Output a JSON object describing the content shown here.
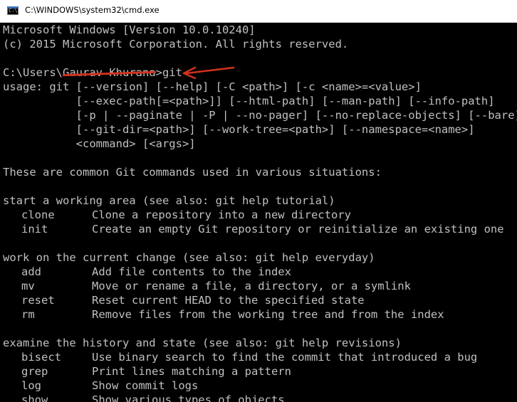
{
  "window": {
    "title": "C:\\WINDOWS\\system32\\cmd.exe",
    "icon": "cmd-console-icon",
    "background_color": "#000000",
    "text_color": "#c0c0c0",
    "annotation_color": "#d2311e"
  },
  "console": {
    "banner_line1": "Microsoft Windows [Version 10.0.10240]",
    "banner_line2": "(c) 2015 Microsoft Corporation. All rights reserved.",
    "prompt_prefix": "C:\\Users\\",
    "prompt_user_redacted": "Gaurav Khurana",
    "prompt_suffix": ">git",
    "usage_lines": [
      "usage: git [--version] [--help] [-C <path>] [-c <name>=<value>]",
      "           [--exec-path[=<path>]] [--html-path] [--man-path] [--info-path]",
      "           [-p | --paginate | -P | --no-pager] [--no-replace-objects] [--bare]",
      "           [--git-dir=<path>] [--work-tree=<path>] [--namespace=<name>]",
      "           <command> [<args>]"
    ],
    "intro": "These are common Git commands used in various situations:",
    "sections": [
      {
        "header": "start a working area (see also: git help tutorial)",
        "commands": [
          {
            "name": "clone",
            "description": "Clone a repository into a new directory"
          },
          {
            "name": "init",
            "description": "Create an empty Git repository or reinitialize an existing one"
          }
        ]
      },
      {
        "header": "work on the current change (see also: git help everyday)",
        "commands": [
          {
            "name": "add",
            "description": "Add file contents to the index"
          },
          {
            "name": "mv",
            "description": "Move or rename a file, a directory, or a symlink"
          },
          {
            "name": "reset",
            "description": "Reset current HEAD to the specified state"
          },
          {
            "name": "rm",
            "description": "Remove files from the working tree and from the index"
          }
        ]
      },
      {
        "header": "examine the history and state (see also: git help revisions)",
        "commands": [
          {
            "name": "bisect",
            "description": "Use binary search to find the commit that introduced a bug"
          },
          {
            "name": "grep",
            "description": "Print lines matching a pattern"
          },
          {
            "name": "log",
            "description": "Show commit logs"
          },
          {
            "name": "show",
            "description": "Show various types of objects"
          }
        ]
      }
    ]
  }
}
